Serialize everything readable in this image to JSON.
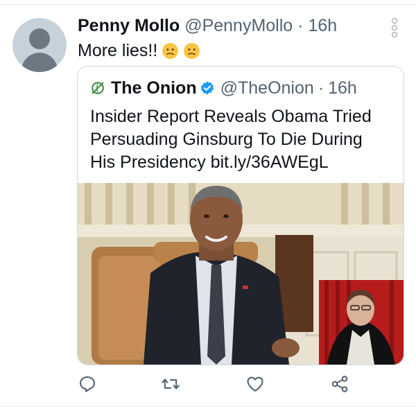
{
  "tweet": {
    "author_name": "Penny Mollo",
    "author_handle": "@PennyMollo",
    "separator": "·",
    "time": "16h",
    "text": "More lies!!",
    "emojis": [
      "confused-face-emoji",
      "confused-face-emoji"
    ]
  },
  "quoted_tweet": {
    "author_name": "The Onion",
    "author_handle": "@TheOnion",
    "separator": "·",
    "time": "16h",
    "verified": true,
    "text": "Insider Report Reveals Obama Tried Persuading Ginsburg To Die During His Presidency bit.ly/36AWEgL",
    "media": "photo"
  },
  "actions": [
    "reply-icon",
    "retweet-icon",
    "like-icon",
    "share-icon"
  ],
  "colors": {
    "text": "#0f1419",
    "secondary": "#536471",
    "verified": "#1d9bf0",
    "action_icon": "#536471",
    "onion_logo": "#3b8a3e"
  }
}
